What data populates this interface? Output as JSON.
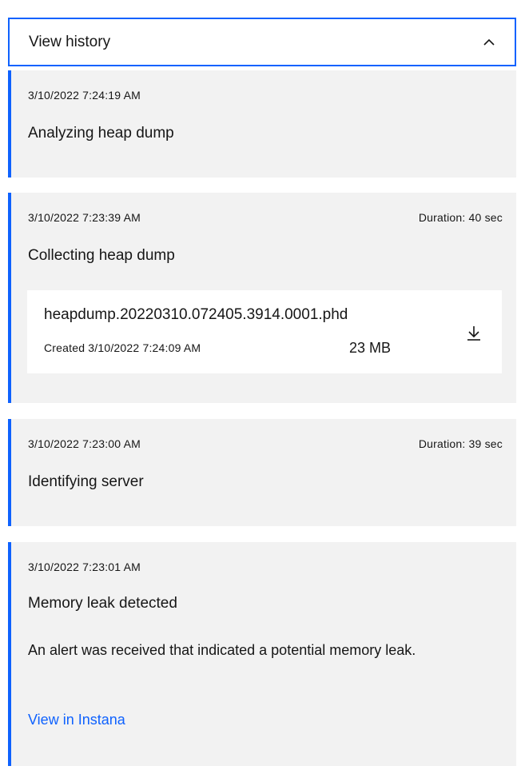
{
  "accordion": {
    "title": "View history",
    "toggle_icon": "chevron-up-icon"
  },
  "history": [
    {
      "timestamp": "3/10/2022 7:24:19 AM",
      "title": "Analyzing heap dump"
    },
    {
      "timestamp": "3/10/2022 7:23:39 AM",
      "duration": "Duration: 40 sec",
      "title": "Collecting heap dump",
      "file": {
        "name": "heapdump.20220310.072405.3914.0001.phd",
        "created": "Created 3/10/2022 7:24:09 AM",
        "size": "23 MB",
        "action_icon": "download-icon"
      }
    },
    {
      "timestamp": "3/10/2022 7:23:00 AM",
      "duration": "Duration: 39 sec",
      "title": "Identifying server"
    },
    {
      "timestamp": "3/10/2022 7:23:01 AM",
      "title": "Memory leak detected",
      "description": "An alert was received that indicated a potential memory leak.",
      "link": "View in Instana"
    }
  ],
  "colors": {
    "accent": "#0f62fe",
    "card_bg": "#f2f2f2",
    "text": "#161616"
  }
}
